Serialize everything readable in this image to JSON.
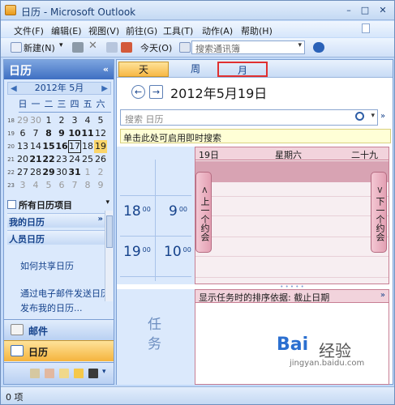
{
  "window": {
    "title": "日历 - Microsoft Outlook"
  },
  "menu": [
    "文件(F)",
    "编辑(E)",
    "视图(V)",
    "前往(G)",
    "工具(T)",
    "动作(A)",
    "帮助(H)"
  ],
  "toolbar": {
    "new_label": "新建(N)",
    "today_label": "今天(O)",
    "search_address_placeholder": "搜索通讯簿"
  },
  "nav": {
    "header": "日历",
    "collapse": "«",
    "minical": {
      "month_label": "2012年 5月",
      "dow": [
        "日",
        "一",
        "二",
        "三",
        "四",
        "五",
        "六"
      ],
      "weeks": [
        {
          "num": "18",
          "days": [
            "29",
            "30",
            "1",
            "2",
            "3",
            "4",
            "5"
          ]
        },
        {
          "num": "19",
          "days": [
            "6",
            "7",
            "8",
            "9",
            "10",
            "11",
            "12"
          ]
        },
        {
          "num": "20",
          "days": [
            "13",
            "14",
            "15",
            "16",
            "17",
            "18",
            "19"
          ]
        },
        {
          "num": "21",
          "days": [
            "20",
            "21",
            "22",
            "23",
            "24",
            "25",
            "26"
          ]
        },
        {
          "num": "22",
          "days": [
            "27",
            "28",
            "29",
            "30",
            "31",
            "1",
            "2"
          ]
        },
        {
          "num": "23",
          "days": [
            "3",
            "4",
            "5",
            "6",
            "7",
            "8",
            "9"
          ]
        }
      ]
    },
    "all_calendar_items": "所有日历项目",
    "my_calendars": "我的日历",
    "people_calendars": "人员日历",
    "links": [
      "如何共享日历",
      "通过电子邮件发送日历",
      "发布我的日历..."
    ],
    "mail_button": "邮件",
    "calendar_button": "日历"
  },
  "views": {
    "day": "天",
    "week": "周",
    "month": "月"
  },
  "date_title": "2012年5月19日",
  "search": {
    "placeholder": "搜索 日历"
  },
  "instant_search_bar": "单击此处可启用即时搜索",
  "dayview": {
    "day_num": "19日",
    "weekday": "星期六",
    "lunar": "二十九",
    "prev_appt": "上一个约会",
    "next_appt": "下一个约会",
    "hours": [
      {
        "big": "18",
        "small": "00",
        "big2": "9",
        "small2": "00"
      },
      {
        "big": "19",
        "small": "00",
        "big2": "10",
        "small2": "00"
      }
    ]
  },
  "tasks": {
    "label": "任务",
    "header": "显示任务时的排序依据: 截止日期"
  },
  "status": {
    "items": "0 项"
  },
  "watermark": {
    "text1": "Bai",
    "text2": "经验",
    "url": "jingyan.baidu.com"
  }
}
